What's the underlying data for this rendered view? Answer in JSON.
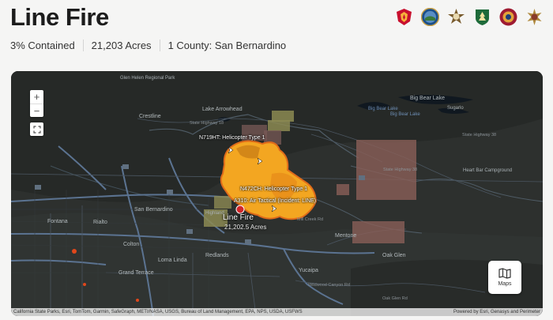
{
  "header": {
    "title": "Line Fire"
  },
  "stats": {
    "containment": "3% Contained",
    "acres": "21,203 Acres",
    "counties": "1 County: San Bernardino"
  },
  "agencies": [
    {
      "icon": "calfire-badge-icon",
      "color": "#c8102e"
    },
    {
      "icon": "sheriff-seal-icon",
      "color": "#1b4f8a"
    },
    {
      "icon": "law-enforcement-star-icon",
      "color": "#7a5c2e"
    },
    {
      "icon": "forest-service-shield-icon",
      "color": "#1e6b3a"
    },
    {
      "icon": "county-fire-seal-icon",
      "color": "#9e1b32"
    },
    {
      "icon": "sheriff-star-icon",
      "color": "#b08a3e"
    }
  ],
  "map": {
    "zoom_in": "+",
    "zoom_out": "−",
    "maps_label": "Maps",
    "fire": {
      "name": "Line Fire",
      "acres": "21,202.5 Acres"
    },
    "assets": [
      "N719HT: Helicopter Type 1",
      "N472CH: Helicopter Type 1",
      "A310: Air Tactical (Incident: LINE)"
    ],
    "places": [
      "Fontana",
      "Rialto",
      "San Bernardino",
      "Highland",
      "Colton",
      "Loma Linda",
      "Redlands",
      "Grand Terrace",
      "Yucaipa",
      "Crestline",
      "Oak Glen",
      "Mentone",
      "Lake Arrowhead",
      "Big Bear Lake",
      "Heart Bar Campground",
      "Sugarlo",
      "Lytle Creek",
      "Glen Helen Regional Park"
    ],
    "lakes": [
      "Lake Arrowhead",
      "Big Bear Lake",
      "Big Bear Lake"
    ],
    "roads": [
      "State Highway 18",
      "State Highway 38",
      "State Highway 38",
      "Mill Creek Rd",
      "Wildwood Canyon Rd",
      "Oak Glen Rd"
    ],
    "attribution_left": "California State Parks, Esri, TomTom, Garmin, SafeGraph, METI/NASA, USGS, Bureau of Land Management, EPA, NPS, USDA, USFWS",
    "attribution_right": "Powered by Esri, Genasys and Perimeter"
  }
}
